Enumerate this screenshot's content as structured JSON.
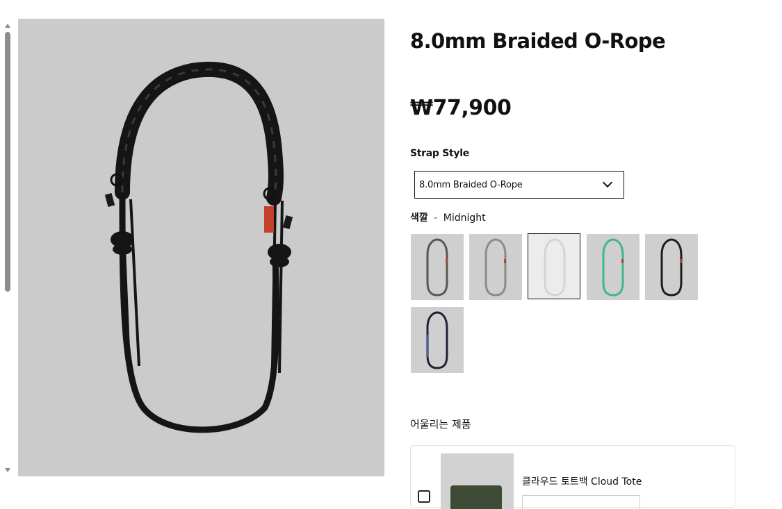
{
  "product": {
    "title": "8.0mm Braided O-Rope",
    "price": "₩77,900",
    "image_alt": "main-product-image"
  },
  "strap_style": {
    "label": "Strap Style",
    "selected": "8.0mm Braided O-Rope"
  },
  "color": {
    "label": "색깔",
    "separator": "-",
    "selected": "Midnight",
    "swatches": [
      {
        "name": "swatch-1",
        "rope": "#5a5650",
        "accent": "#c2402c"
      },
      {
        "name": "swatch-2",
        "rope": "#8a8a86",
        "accent": "#c2402c"
      },
      {
        "name": "swatch-3",
        "rope": "#f2f2f2",
        "accent": "#dcdcdc",
        "selected": true
      },
      {
        "name": "swatch-4",
        "rope": "#3fb592",
        "accent": "#c2402c"
      },
      {
        "name": "swatch-5",
        "rope": "#1d1d1d",
        "accent": "#c2402c"
      },
      {
        "name": "swatch-6",
        "rope": "#1e2236",
        "accent": "#4a59b0"
      }
    ]
  },
  "matching": {
    "title": "어울리는 제품",
    "item_name": "클라우드 토트백 Cloud Tote"
  },
  "colors": {
    "image_bg": "#cbcbcb",
    "rope_main": "#141414",
    "accent_red": "#c2402c"
  }
}
